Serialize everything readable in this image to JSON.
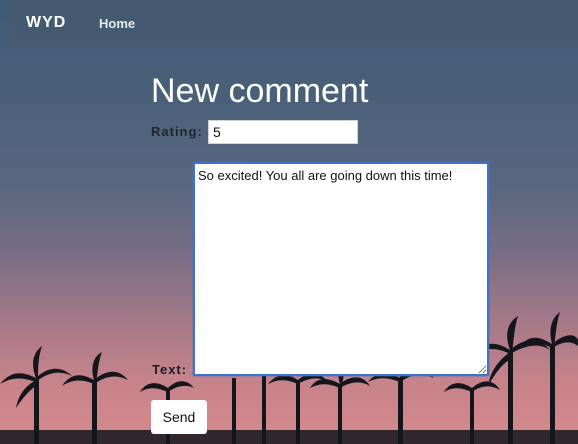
{
  "navbar": {
    "brand": "WYD",
    "home_label": "Home"
  },
  "form": {
    "title": "New comment",
    "rating_label": "Rating:",
    "rating_value": "5",
    "text_label": "Text:",
    "text_value": "So excited! You all are going down this time!",
    "send_label": "Send"
  },
  "colors": {
    "textarea_focus_border": "#3f73c9",
    "navbar_text": "#ffffff"
  }
}
